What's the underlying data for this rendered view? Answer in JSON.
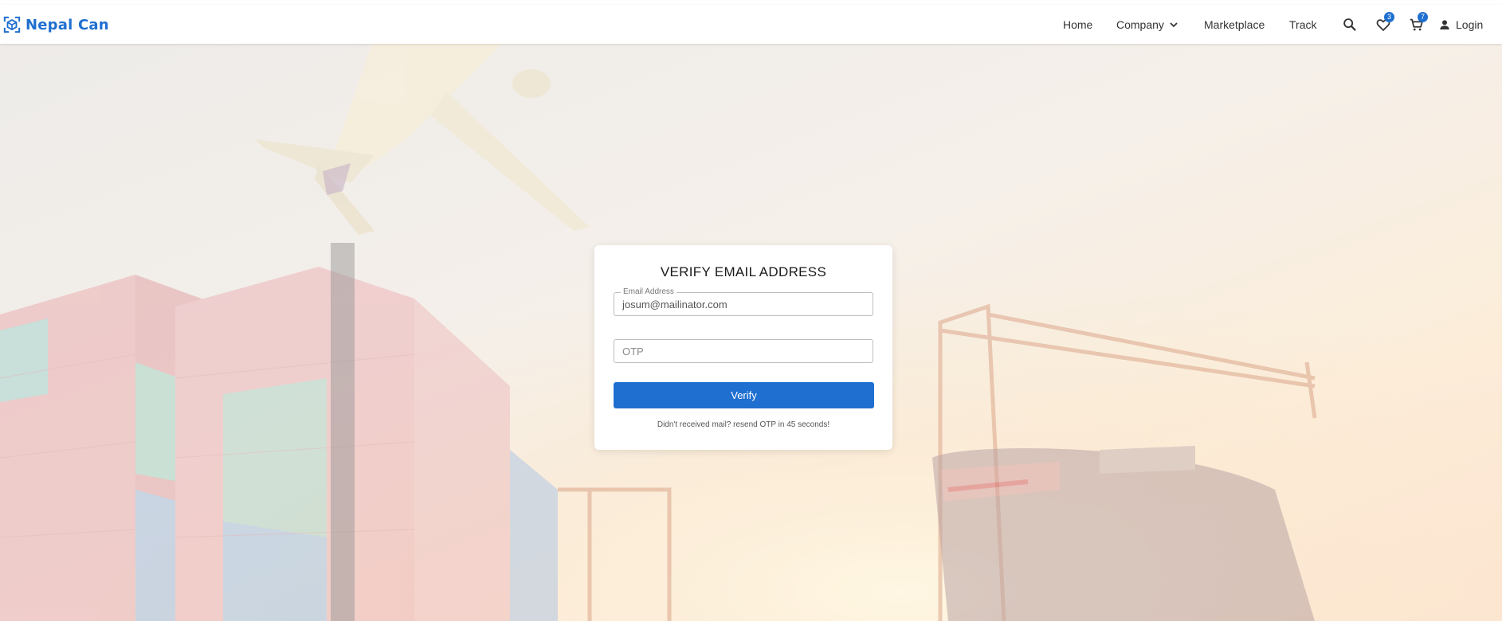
{
  "header": {
    "brand": "Nepal Can",
    "nav": {
      "home": "Home",
      "company": "Company",
      "marketplace": "Marketplace",
      "track": "Track"
    },
    "wishlist_count": "3",
    "cart_count": "7",
    "login": "Login",
    "icons": [
      "logo-icon",
      "chevron-down-icon",
      "search-icon",
      "heart-icon",
      "cart-icon",
      "person-icon"
    ]
  },
  "card": {
    "title": "VERIFY EMAIL ADDRESS",
    "email_label": "Email Address",
    "email_value": "josum@mailinator.com",
    "otp_placeholder": "OTP",
    "verify_label": "Verify",
    "resend_prefix": "Didn't received mail? ",
    "resend_link": "resend OTP",
    "resend_suffix": " in 45 seconds!"
  },
  "colors": {
    "accent": "#1e6fd0",
    "text": "#333333",
    "card_bg": "#ffffff"
  }
}
